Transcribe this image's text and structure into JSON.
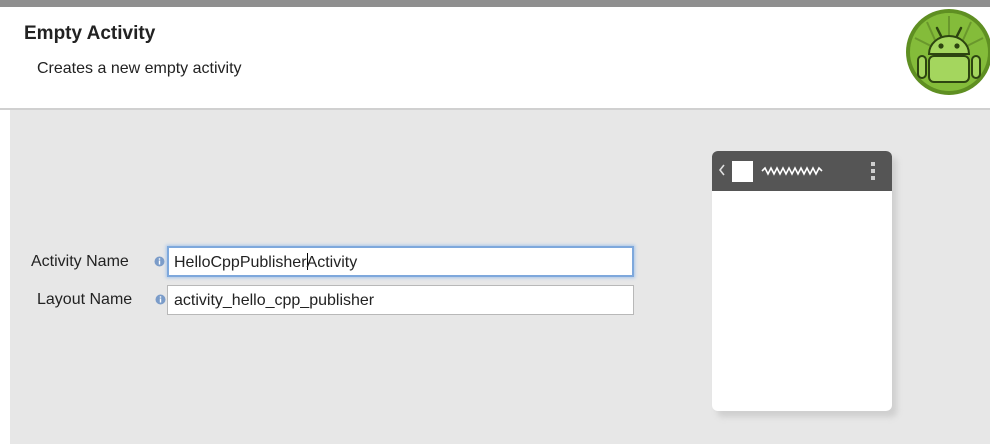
{
  "header": {
    "title": "Empty Activity",
    "subtitle": "Creates a new empty activity",
    "logo_icon": "android-robot-icon"
  },
  "form": {
    "activity_name": {
      "label": "Activity Name",
      "value": "HelloCppPublisherActivity",
      "value_before_caret": "HelloCppPublisher",
      "value_after_caret": "Activity",
      "info_icon": "info-icon",
      "focused": true
    },
    "layout_name": {
      "label": "Layout Name",
      "value": "activity_hello_cpp_publisher",
      "info_icon": "info-icon"
    }
  },
  "preview": {
    "description_icon": "phone-preview-icon",
    "action_bar_icons": [
      "back-chevron-icon",
      "app-icon",
      "title-squiggle-icon",
      "overflow-menu-icon"
    ]
  },
  "colors": {
    "content_bg": "#e7e7e7",
    "action_bar": "#555555",
    "focus_ring": "#7ea8dc",
    "android_green": "#8dc63f"
  }
}
